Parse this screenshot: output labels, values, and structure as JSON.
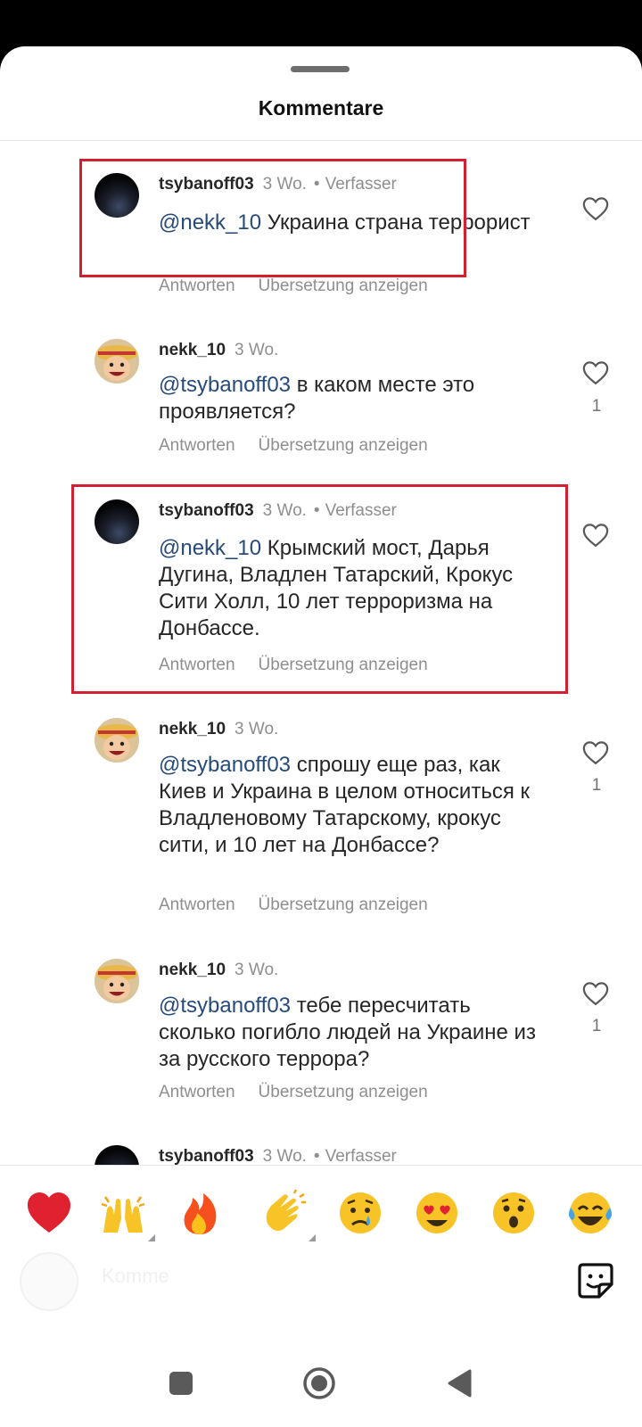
{
  "sheet": {
    "title": "Kommentare"
  },
  "comments": [
    {
      "user": "tsybanoff03",
      "time": "3 Wo.",
      "dot": "•",
      "author": "Verfasser",
      "mention": "@nekk_10",
      "text": " Украина страна террорист",
      "reply": "Antworten",
      "translate": "Übersetzung anzeigen",
      "likes": ""
    },
    {
      "user": "nekk_10",
      "time": "3 Wo.",
      "dot": "",
      "author": "",
      "mention": "@tsybanoff03",
      "text": " в каком месте это проявляется?",
      "reply": "Antworten",
      "translate": "Übersetzung anzeigen",
      "likes": "1"
    },
    {
      "user": "tsybanoff03",
      "time": "3 Wo.",
      "dot": "•",
      "author": "Verfasser",
      "mention": "@nekk_10",
      "text": " Крымский мост, Дарья Дугина, Владлен Татарский, Крокус Сити Холл, 10 лет терроризма на Донбассе.",
      "reply": "Antworten",
      "translate": "Übersetzung anzeigen",
      "likes": ""
    },
    {
      "user": "nekk_10",
      "time": "3 Wo.",
      "dot": "",
      "author": "",
      "mention": "@tsybanoff03",
      "text": " спрошу еще раз, как Киев и Украина в целом относиться к Владленовому Татарскому, крокус сити, и 10 лет на Донбассе?",
      "reply": "Antworten",
      "translate": "Übersetzung anzeigen",
      "likes": "1"
    },
    {
      "user": "nekk_10",
      "time": "3 Wo.",
      "dot": "",
      "author": "",
      "mention": "@tsybanoff03",
      "text": " тебе пересчитать сколько погибло людей на Украине из за русского террора?",
      "reply": "Antworten",
      "translate": "Übersetzung anzeigen",
      "likes": "1"
    },
    {
      "user": "tsybanoff03",
      "time": "3 Wo.",
      "dot": "•",
      "author": "Verfasser",
      "mention": "",
      "text": "",
      "reply": "",
      "translate": "",
      "likes": ""
    }
  ],
  "emoji_bar": [
    "red-heart",
    "raising-hands",
    "fire",
    "clapping-hands",
    "crying-face",
    "heart-eyes-face",
    "astonished-face",
    "tears-of-joy-face"
  ],
  "input": {
    "placeholder_ghost": "Komme"
  },
  "colors": {
    "highlight": "#d32030",
    "mention": "#264a7a",
    "muted": "#8e8e8e"
  }
}
